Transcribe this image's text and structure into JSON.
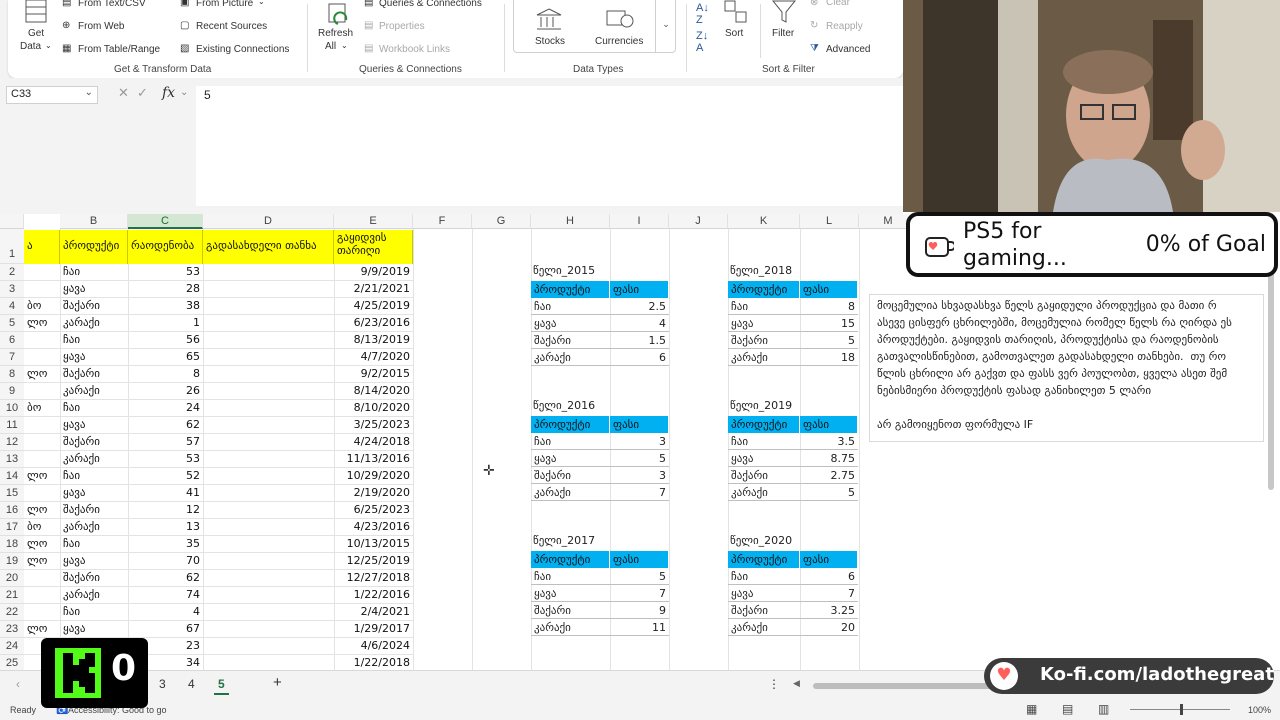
{
  "ribbon": {
    "get_data": {
      "line1": "Get",
      "line2": "Data"
    },
    "from_text_csv": "From Text/CSV",
    "from_web": "From Web",
    "from_table_range": "From Table/Range",
    "from_picture": "From Picture",
    "recent_sources": "Recent Sources",
    "existing_connections": "Existing Connections",
    "group_get_transform": "Get & Transform Data",
    "refresh": {
      "line1": "Refresh",
      "line2": "All"
    },
    "queries_connections": "Queries & Connections",
    "properties": "Properties",
    "workbook_links": "Workbook Links",
    "group_queries": "Queries & Connections",
    "stocks": "Stocks",
    "currencies": "Currencies",
    "group_data_types": "Data Types",
    "sort": "Sort",
    "filter": "Filter",
    "clear": "Clear",
    "reapply": "Reapply",
    "advanced": "Advanced",
    "group_sort_filter": "Sort & Filter"
  },
  "formula_bar": {
    "name_box": "C33",
    "fx": "fx",
    "value": "5"
  },
  "columns": [
    "B",
    "C",
    "D",
    "E",
    "F",
    "G",
    "H",
    "I",
    "J",
    "K",
    "L",
    "M"
  ],
  "header_row": {
    "a": "ა",
    "b": "პროდუქტი",
    "c": "რაოდენობა",
    "d": "გადასახდელი თანხა",
    "e": "გაყიდვის თარიღი"
  },
  "rows": [
    {
      "n": "2",
      "a": "",
      "b": "ჩაი",
      "c": "53",
      "e": "9/9/2019"
    },
    {
      "n": "3",
      "a": "",
      "b": "ყავა",
      "c": "28",
      "e": "2/21/2021"
    },
    {
      "n": "4",
      "a": "ბო",
      "b": "შაქარი",
      "c": "38",
      "e": "4/25/2019"
    },
    {
      "n": "5",
      "a": "ლო",
      "b": "კარაქი",
      "c": "1",
      "e": "6/23/2016"
    },
    {
      "n": "6",
      "a": "",
      "b": "ჩაი",
      "c": "56",
      "e": "8/13/2019"
    },
    {
      "n": "7",
      "a": "",
      "b": "ყავა",
      "c": "65",
      "e": "4/7/2020"
    },
    {
      "n": "8",
      "a": "ლო",
      "b": "შაქარი",
      "c": "8",
      "e": "9/2/2015"
    },
    {
      "n": "9",
      "a": "",
      "b": "კარაქი",
      "c": "26",
      "e": "8/14/2020"
    },
    {
      "n": "10",
      "a": "ბო",
      "b": "ჩაი",
      "c": "24",
      "e": "8/10/2020"
    },
    {
      "n": "11",
      "a": "",
      "b": "ყავა",
      "c": "62",
      "e": "3/25/2023"
    },
    {
      "n": "12",
      "a": "",
      "b": "შაქარი",
      "c": "57",
      "e": "4/24/2018"
    },
    {
      "n": "13",
      "a": "",
      "b": "კარაქი",
      "c": "53",
      "e": "11/13/2016"
    },
    {
      "n": "14",
      "a": "ლო",
      "b": "ჩაი",
      "c": "52",
      "e": "10/29/2020"
    },
    {
      "n": "15",
      "a": "",
      "b": "ყავა",
      "c": "41",
      "e": "2/19/2020"
    },
    {
      "n": "16",
      "a": "ლო",
      "b": "შაქარი",
      "c": "12",
      "e": "6/25/2023"
    },
    {
      "n": "17",
      "a": "ბო",
      "b": "კარაქი",
      "c": "13",
      "e": "4/23/2016"
    },
    {
      "n": "18",
      "a": "ლო",
      "b": "ჩაი",
      "c": "35",
      "e": "10/13/2015"
    },
    {
      "n": "19",
      "a": "ლო",
      "b": "ყავა",
      "c": "70",
      "e": "12/25/2019"
    },
    {
      "n": "20",
      "a": "",
      "b": "შაქარი",
      "c": "62",
      "e": "12/27/2018"
    },
    {
      "n": "21",
      "a": "",
      "b": "კარაქი",
      "c": "74",
      "e": "1/22/2016"
    },
    {
      "n": "22",
      "a": "",
      "b": "ჩაი",
      "c": "4",
      "e": "2/4/2021"
    },
    {
      "n": "23",
      "a": "ლო",
      "b": "ყავა",
      "c": "67",
      "e": "1/29/2017"
    },
    {
      "n": "24",
      "a": "",
      "b": "",
      "c": "23",
      "e": "4/6/2024"
    },
    {
      "n": "25",
      "a": "",
      "b": "",
      "c": "34",
      "e": "1/22/2018"
    }
  ],
  "price_tables": [
    {
      "title": "წელი_2015",
      "h1": "პროდუქტი",
      "h2": "ფასი",
      "rows": [
        [
          "ჩაი",
          "2.5"
        ],
        [
          "ყავა",
          "4"
        ],
        [
          "შაქარი",
          "1.5"
        ],
        [
          "კარაქი",
          "6"
        ]
      ]
    },
    {
      "title": "წელი_2018",
      "h1": "პროდუქტი",
      "h2": "ფასი",
      "rows": [
        [
          "ჩაი",
          "8"
        ],
        [
          "ყავა",
          "15"
        ],
        [
          "შაქარი",
          "5"
        ],
        [
          "კარაქი",
          "18"
        ]
      ]
    },
    {
      "title": "წელი_2016",
      "h1": "პროდუქტი",
      "h2": "ფასი",
      "rows": [
        [
          "ჩაი",
          "3"
        ],
        [
          "ყავა",
          "5"
        ],
        [
          "შაქარი",
          "3"
        ],
        [
          "კარაქი",
          "7"
        ]
      ]
    },
    {
      "title": "წელი_2019",
      "h1": "პროდუქტი",
      "h2": "ფასი",
      "rows": [
        [
          "ჩაი",
          "3.5"
        ],
        [
          "ყავა",
          "8.75"
        ],
        [
          "შაქარი",
          "2.75"
        ],
        [
          "კარაქი",
          "5"
        ]
      ]
    },
    {
      "title": "წელი_2017",
      "h1": "პროდუქტი",
      "h2": "ფასი",
      "rows": [
        [
          "ჩაი",
          "5"
        ],
        [
          "ყავა",
          "7"
        ],
        [
          "შაქარი",
          "9"
        ],
        [
          "კარაქი",
          "11"
        ]
      ]
    },
    {
      "title": "წელი_2020",
      "h1": "პროდუქტი",
      "h2": "ფასი",
      "rows": [
        [
          "ჩაი",
          "6"
        ],
        [
          "ყავა",
          "7"
        ],
        [
          "შაქარი",
          "3.25"
        ],
        [
          "კარაქი",
          "20"
        ]
      ]
    }
  ],
  "task_box": {
    "p1": "მოცემულია სხვადასხვა წელს გაყიდული პროდუქცია და მათი რ\nასევე ცისფერ ცხრილებში, მოცემულია რომელ წელს რა ღირდა ეს\nპროდუქტები. გაყიდვის თარიღის, პროდუქტისა და რაოდენობის\nგათვალისწინებით, გამოთვალეთ გადასახდელი თანხები.  თუ რო\nწლის ცხრილი არ გაქვთ და ფასს ვერ პოულობთ, ყველა ასეთ შემ\nნებისმიერი პროდუქტის ფასად განიხილეთ 5 ლარი",
    "p2": "არ გამოიყენოთ ფორმულა IF"
  },
  "sheet_tabs": {
    "tabs": [
      "3",
      "4",
      "5"
    ],
    "active": "5",
    "add": "+"
  },
  "status_bar": {
    "ready": "Ready",
    "accessibility": "Accessibility: Good to go",
    "zoom": "100%"
  },
  "overlays": {
    "goal_text": "PS5 for gaming...",
    "goal_progress": "0% of Goal",
    "kofi_text": "Ko-fi.com/ladothegreat",
    "badge_count": "0"
  },
  "colors": {
    "accent": "#217346",
    "yellow_header": "#ffff00",
    "table_header": "#00b0f0"
  }
}
